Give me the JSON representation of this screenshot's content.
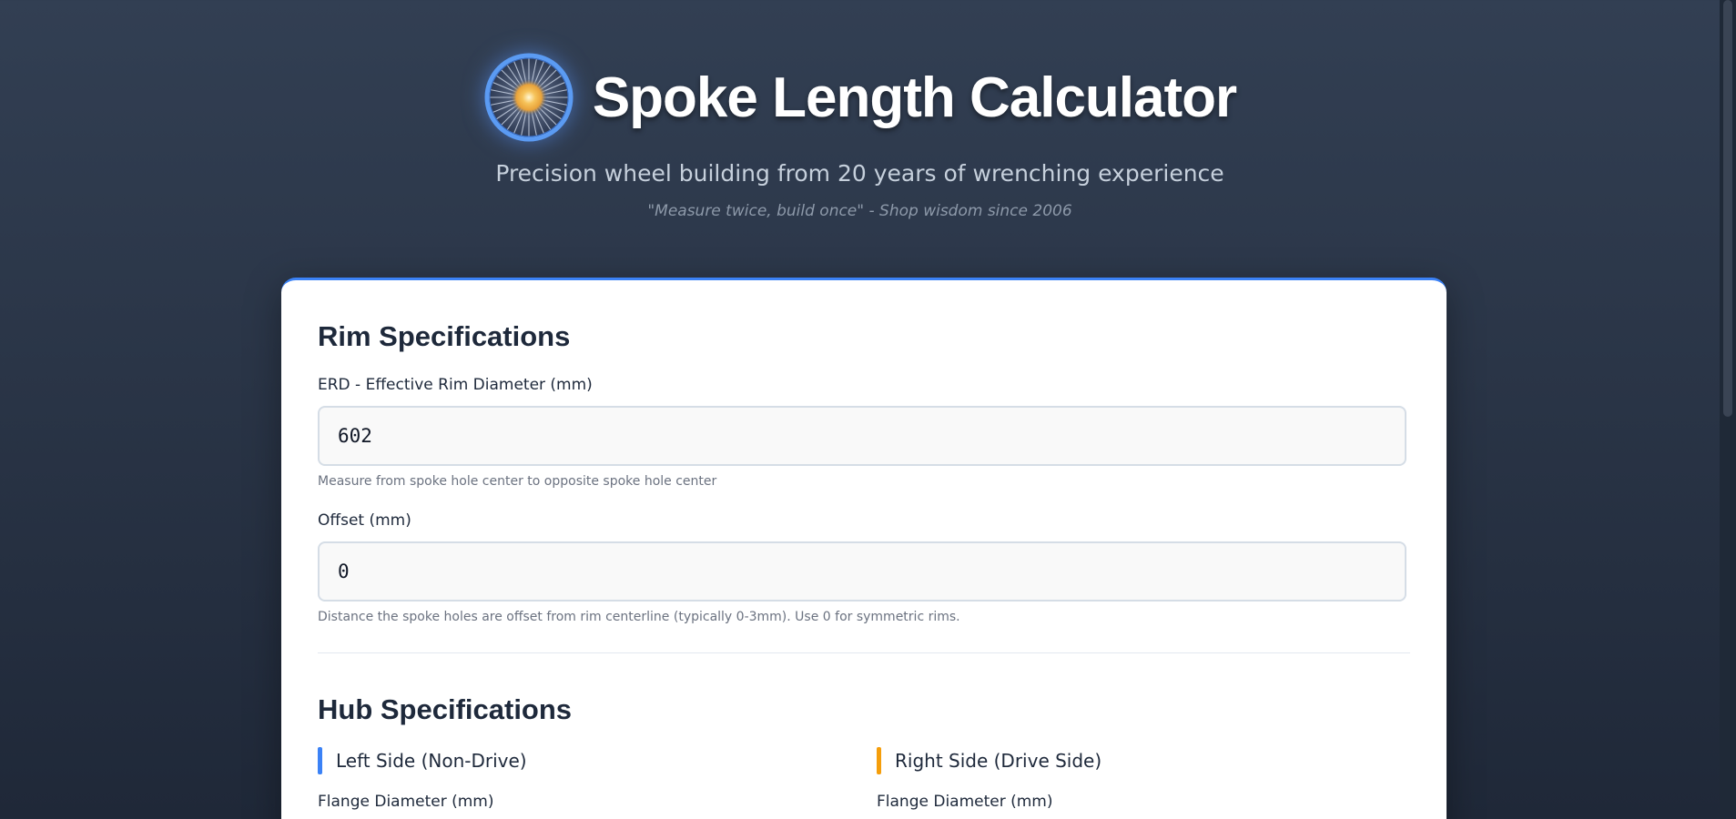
{
  "header": {
    "title": "Spoke Length Calculator",
    "subtitle": "Precision wheel building from 20 years of wrenching experience",
    "quote": "\"Measure twice, build once\" - Shop wisdom since 2006",
    "logo_icon": "spoked-wheel-icon"
  },
  "rim": {
    "title": "Rim Specifications",
    "erd_label": "ERD - Effective Rim Diameter (mm)",
    "erd_value": "602",
    "erd_hint": "Measure from spoke hole center to opposite spoke hole center",
    "offset_label": "Offset (mm)",
    "offset_value": "0",
    "offset_hint": "Distance the spoke holes are offset from rim centerline (typically 0-3mm). Use 0 for symmetric rims."
  },
  "hub": {
    "title": "Hub Specifications",
    "left": {
      "heading": "Left Side (Non-Drive)",
      "flange_label": "Flange Diameter (mm)",
      "accent": "#3b82f6"
    },
    "right": {
      "heading": "Right Side (Drive Side)",
      "flange_label": "Flange Diameter (mm)",
      "accent": "#f59e0b"
    }
  },
  "colors": {
    "background": "#2a3547",
    "card": "#ffffff",
    "card_top_accent": "#3b82f6",
    "heading_text": "#1e293b",
    "hint_text": "#6b7280"
  }
}
